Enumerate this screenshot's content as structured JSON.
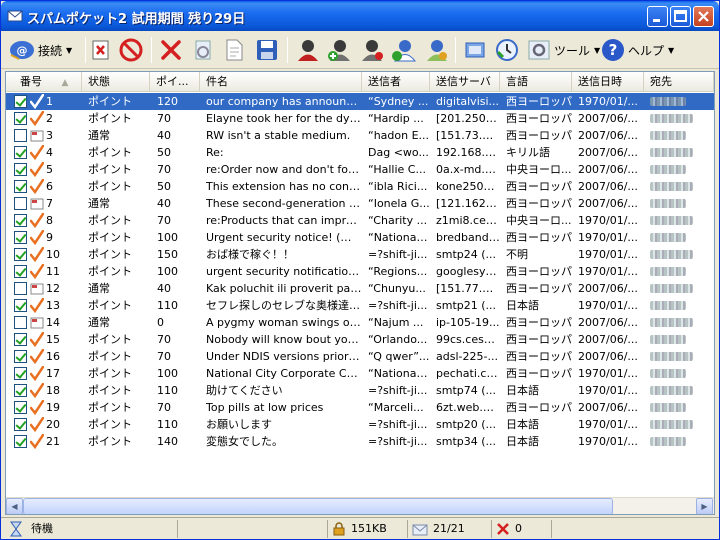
{
  "window": {
    "title": "スパムポケット2 試用期間 残り29日"
  },
  "toolbar": {
    "receive_label": "接続",
    "tools_label": "ツール",
    "help_label": "ヘルプ"
  },
  "columns": [
    "番号",
    "状態",
    "ポイ...",
    "件名",
    "送信者",
    "送信サーバ",
    "言語",
    "送信日時",
    "宛先"
  ],
  "rows": [
    {
      "checked": true,
      "mark": "check",
      "no": "1",
      "state": "ポイント",
      "points": "120",
      "subject": "our company has announce...",
      "sender": "“Sydney ...",
      "server": "digitalvisi...",
      "lang": "西ヨーロッパ",
      "date": "1970/01/...",
      "selected": true
    },
    {
      "checked": true,
      "mark": "check",
      "no": "2",
      "state": "ポイント",
      "points": "70",
      "subject": "Elayne took her for the dyi...",
      "sender": "“Hardip ...",
      "server": "[201.250.2...",
      "lang": "西ヨーロッパ",
      "date": "2007/06/..."
    },
    {
      "checked": false,
      "mark": "mail",
      "no": "3",
      "state": "通常",
      "points": "40",
      "subject": "RW isn't a stable medium.",
      "sender": "“hadon E...",
      "server": "[151.73.69...",
      "lang": "西ヨーロッパ",
      "date": "2007/06/..."
    },
    {
      "checked": true,
      "mark": "check",
      "no": "4",
      "state": "ポイント",
      "points": "50",
      "subject": "Re:",
      "sender": "Dag <wo...",
      "server": "192.168.1...",
      "lang": "キリル語",
      "date": "2007/06/..."
    },
    {
      "checked": true,
      "mark": "check",
      "no": "5",
      "state": "ポイント",
      "points": "70",
      "subject": "re:Order now and don't forg...",
      "sender": "“Hallie C...",
      "server": "0a.x-md.d...",
      "lang": "中央ヨーロ...",
      "date": "2007/06/..."
    },
    {
      "checked": true,
      "mark": "check",
      "no": "6",
      "state": "ポイント",
      "points": "50",
      "subject": "This extension has no confi...",
      "sender": "“ibla Rici...",
      "server": "kone2501...",
      "lang": "西ヨーロッパ",
      "date": "2007/06/..."
    },
    {
      "checked": false,
      "mark": "mail",
      "no": "7",
      "state": "通常",
      "points": "40",
      "subject": "These second-generation s...",
      "sender": "“Ionela G...",
      "server": "[121.162.7...",
      "lang": "西ヨーロッパ",
      "date": "2007/06/..."
    },
    {
      "checked": true,
      "mark": "check",
      "no": "8",
      "state": "ポイント",
      "points": "70",
      "subject": "re:Products that can improv...",
      "sender": "“Charity ...",
      "server": "z1mi8.cert...",
      "lang": "中央ヨーロ...",
      "date": "1970/01/..."
    },
    {
      "checked": true,
      "mark": "check",
      "no": "9",
      "state": "ポイント",
      "points": "100",
      "subject": "Urgent security notice! (me...",
      "sender": "“National...",
      "server": "bredband....",
      "lang": "西ヨーロッパ",
      "date": "1970/01/..."
    },
    {
      "checked": true,
      "mark": "check",
      "no": "10",
      "state": "ポイント",
      "points": "150",
      "subject": "おば様で稼ぐ！！",
      "sender": "=?shift-ji...",
      "server": "smtp24 (...",
      "lang": "不明",
      "date": "1970/01/..."
    },
    {
      "checked": true,
      "mark": "check",
      "no": "11",
      "state": "ポイント",
      "points": "100",
      "subject": "urgent security notification ...",
      "sender": "“Regions...",
      "server": "googlesyn...",
      "lang": "西ヨーロッパ",
      "date": "1970/01/..."
    },
    {
      "checked": false,
      "mark": "mail",
      "no": "12",
      "state": "通常",
      "points": "40",
      "subject": "Kak poluchit ili proverit pas...",
      "sender": "“Chunyu...",
      "server": "[151.77.23...",
      "lang": "西ヨーロッパ",
      "date": "2007/06/..."
    },
    {
      "checked": true,
      "mark": "check",
      "no": "13",
      "state": "ポイント",
      "points": "110",
      "subject": "セフレ探しのセレブな奥様達が...",
      "sender": "=?shift-ji...",
      "server": "smtp21 (...",
      "lang": "日本語",
      "date": "1970/01/..."
    },
    {
      "checked": false,
      "mark": "mail",
      "no": "14",
      "state": "通常",
      "points": "0",
      "subject": "A pygmy woman swings on...",
      "sender": "“Najum ...",
      "server": "ip-105-19...",
      "lang": "西ヨーロッパ",
      "date": "2007/06/..."
    },
    {
      "checked": true,
      "mark": "check",
      "no": "15",
      "state": "ポイント",
      "points": "70",
      "subject": "Nobody will know bout your...",
      "sender": "“Orlando...",
      "server": "99cs.cesc...",
      "lang": "西ヨーロッパ",
      "date": "2007/06/..."
    },
    {
      "checked": true,
      "mark": "check",
      "no": "16",
      "state": "ポイント",
      "points": "70",
      "subject": "Under NDIS versions prior t...",
      "sender": "“Q qwer”...",
      "server": "adsl-225-...",
      "lang": "西ヨーロッパ",
      "date": "2007/06/..."
    },
    {
      "checked": true,
      "mark": "check",
      "no": "17",
      "state": "ポイント",
      "points": "100",
      "subject": "National City Corporate Cu...",
      "sender": "“National...",
      "server": "pechati.co...",
      "lang": "西ヨーロッパ",
      "date": "1970/01/..."
    },
    {
      "checked": true,
      "mark": "check",
      "no": "18",
      "state": "ポイント",
      "points": "110",
      "subject": "助けてください",
      "sender": "=?shift-ji...",
      "server": "smtp74 (...",
      "lang": "日本語",
      "date": "1970/01/..."
    },
    {
      "checked": true,
      "mark": "check",
      "no": "19",
      "state": "ポイント",
      "points": "70",
      "subject": "Top pills at low prices",
      "sender": "“Marceli...",
      "server": "6zt.web.ad...",
      "lang": "西ヨーロッパ",
      "date": "2007/06/..."
    },
    {
      "checked": true,
      "mark": "check",
      "no": "20",
      "state": "ポイント",
      "points": "110",
      "subject": "お願いします",
      "sender": "=?shift-ji...",
      "server": "smtp20 (...",
      "lang": "日本語",
      "date": "1970/01/..."
    },
    {
      "checked": true,
      "mark": "check",
      "no": "21",
      "state": "ポイント",
      "points": "140",
      "subject": "変態女でした。",
      "sender": "=?shift-ji...",
      "server": "smtp34 (...",
      "lang": "日本語",
      "date": "1970/01/..."
    }
  ],
  "status": {
    "state": "待機",
    "size": "151KB",
    "count": "21/21",
    "errors": "0"
  },
  "colors": {
    "selection": "#316ac5",
    "titlebar": "#0a58d8",
    "accent_red": "#d42020"
  }
}
